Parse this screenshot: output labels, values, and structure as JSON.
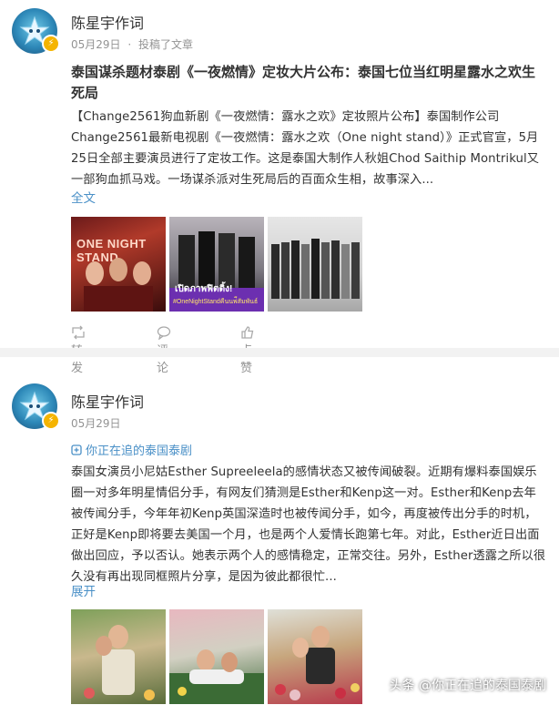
{
  "posts": [
    {
      "author": "陈星宇作词",
      "date": "05月29日",
      "action": "投稿了文章",
      "title": "泰国谋杀题材泰剧《一夜燃情》定妆大片公布：泰国七位当红明星露水之欢生死局",
      "body": "【Change2561狗血新剧《一夜燃情：露水之欢》定妆照片公布】泰国制作公司Change2561最新电视剧《一夜燃情：露水之欢（One night stand）》正式官宣，5月25日全部主要演员进行了定妆工作。这是泰国大制作人秋姐Chod Saithip Montrikul又一部狗血抓马戏。一场谋杀派对生死局后的百面众生相，故事深入...",
      "more": "全文",
      "images": [
        {
          "caption": "ONE NIGHT STAND"
        },
        {
          "caption": "เปิดภาพฟิตติ้ง!",
          "tag": "#OneNightStandคืนนพ่ีสัมพันธ์"
        },
        {
          "caption": ""
        }
      ],
      "actions": {
        "repost": "转发",
        "comment": "评论",
        "like": "点赞"
      }
    },
    {
      "author": "陈星宇作词",
      "date": "05月29日",
      "topic": "你正在追的泰国泰剧",
      "body": "泰国女演员小尼姑Esther Supreeleela的感情状态又被传闻破裂。近期有爆料泰国娱乐圈一对多年明星情侣分手，有网友们猜测是Esther和Kenp这一对。Esther和Kenp去年被传闻分手，今年年初Kenp英国深造时也被传闻分手，如今，再度被传出分手的时机，正好是Kenp即将要去美国一个月，也是两个人爱情长跑第七年。对此，Esther近日出面做出回应，予以否认。她表示两个人的感情稳定，正常交往。另外，Esther透露之所以很久没有再出现同框照片分享，是因为彼此都很忙...",
      "more": "展开"
    }
  ],
  "watermark": "头条 @你正在追的泰国泰剧",
  "colors": {
    "link": "#4a90c7",
    "meta": "#939393",
    "badge": "#f5b400",
    "separator": "#f2f2f2"
  }
}
